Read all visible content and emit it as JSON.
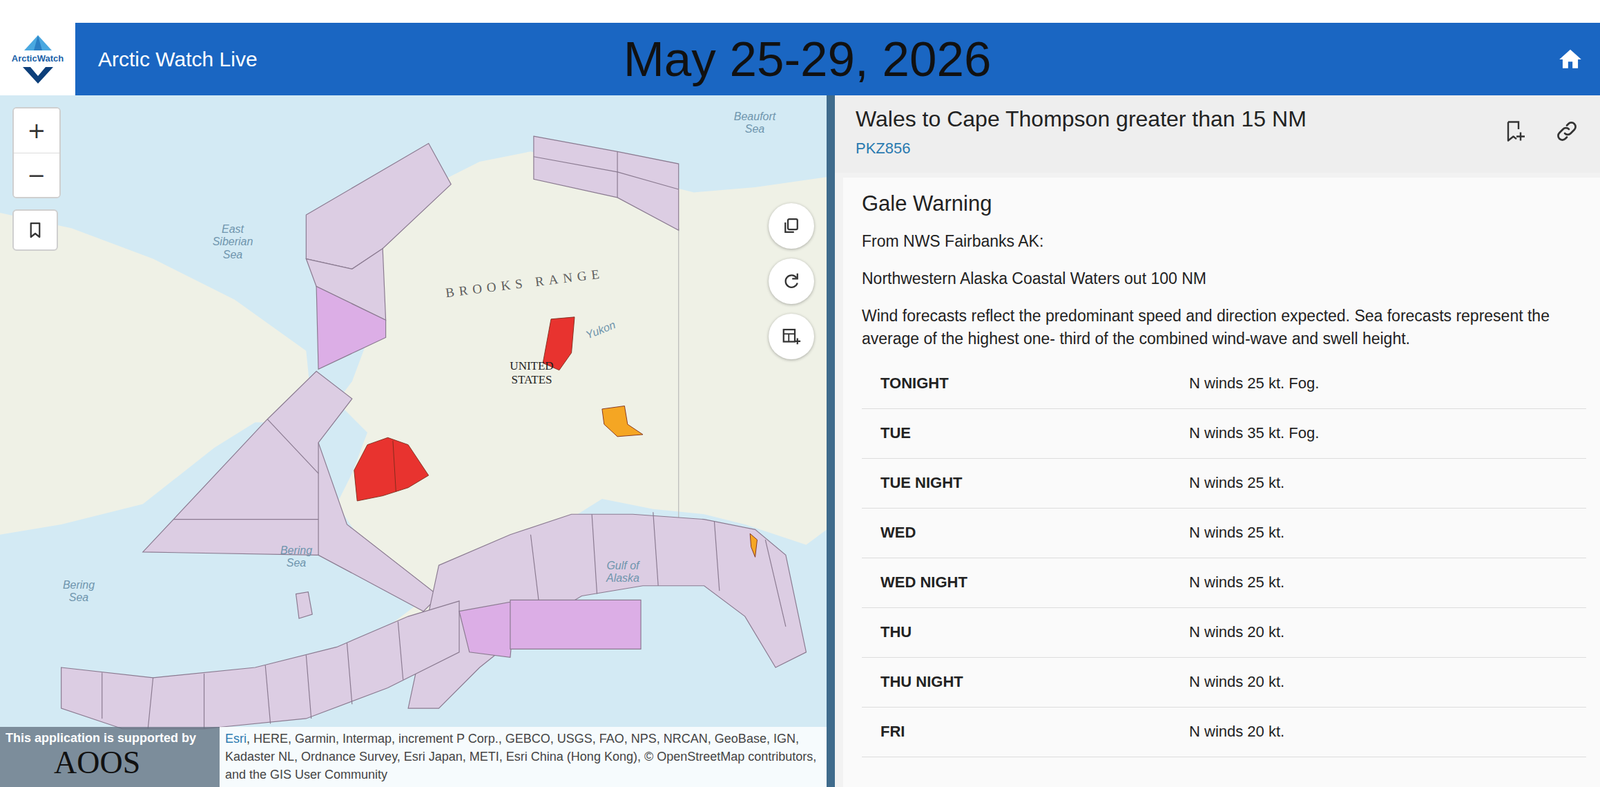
{
  "header": {
    "logo_text": "ArcticWatch",
    "app_title": "Arctic Watch Live",
    "date": "May 25-29, 2026"
  },
  "map": {
    "zoom": [
      "+",
      "−"
    ],
    "labels": [
      "Beaufort Sea",
      "East Siberian Sea",
      "BROOKS RANGE",
      "Yukon",
      "UNITED STATES",
      "Bering Sea",
      "Bering Sea",
      "Gulf of Alaska"
    ],
    "alerts": [
      {
        "color": "#e8332f"
      },
      {
        "color": "#e8332f"
      },
      {
        "color": "#f5a623"
      },
      {
        "color": "#f5a623"
      }
    ],
    "supported_by": "This application is supported by",
    "supporter": "AOOS",
    "attribution_link": "Esri",
    "attribution": ", HERE, Garmin, Intermap, increment P Corp., GEBCO, USGS, FAO, NPS, NRCAN, GeoBase, IGN, Kadaster NL, Ordnance Survey, Esri Japan, METI, Esri China (Hong Kong), © OpenStreetMap contributors, and the GIS User Community"
  },
  "zone": {
    "title": "Wales to Cape Thompson greater than 15 NM",
    "id": "PKZ856"
  },
  "warning": {
    "title": "Gale Warning",
    "source": "From NWS Fairbanks AK:",
    "area": "Northwestern Alaska Coastal Waters out 100 NM",
    "note": "Wind forecasts reflect the predominant speed and direction expected. Sea forecasts represent the average of the highest one- third of the combined wind-wave and swell height.",
    "forecast": [
      {
        "period": "TONIGHT",
        "text": "N winds 25 kt. Fog."
      },
      {
        "period": "TUE",
        "text": "N winds 35 kt. Fog."
      },
      {
        "period": "TUE NIGHT",
        "text": "N winds 25 kt."
      },
      {
        "period": "WED",
        "text": "N winds 25 kt."
      },
      {
        "period": "WED NIGHT",
        "text": "N winds 25 kt."
      },
      {
        "period": "THU",
        "text": "N winds 20 kt."
      },
      {
        "period": "THU NIGHT",
        "text": "N winds 20 kt."
      },
      {
        "period": "FRI",
        "text": "N winds 20 kt."
      }
    ]
  }
}
